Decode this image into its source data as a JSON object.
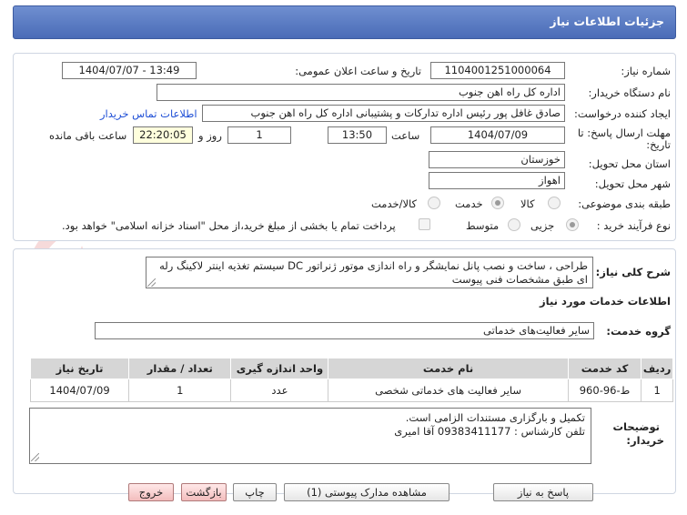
{
  "header": {
    "title": "جزئیات اطلاعات نیاز"
  },
  "form": {
    "need_number_label": "شماره نیاز:",
    "need_number": "1104001251000064",
    "announce_label": "تاریخ و ساعت اعلان عمومی:",
    "announce_value": "1404/07/07 - 13:49",
    "buyer_org_label": "نام دستگاه خریدار:",
    "buyer_org": "اداره کل راه اهن جنوب",
    "creator_label": "ایجاد کننده درخواست:",
    "creator": "صادق غافل پور رئیس اداره تدارکات و پشتیبانی اداره کل راه اهن جنوب",
    "contact_link": "اطلاعات تماس خریدار",
    "deadline_label_1": "مهلت ارسال پاسخ: تا",
    "deadline_label_2": "تاریخ:",
    "deadline_date": "1404/07/09",
    "time_label": "ساعت",
    "deadline_time": "13:50",
    "days_value": "1",
    "days_label": "روز و",
    "remaining_time": "22:20:05",
    "remaining_label": "ساعت باقی مانده",
    "province_label": "استان محل تحویل:",
    "province": "خوزستان",
    "city_label": "شهر محل تحویل:",
    "city": "اهواز",
    "category_label": "طبقه بندی موضوعی:",
    "category_options": [
      "کالا",
      "خدمت",
      "کالا/خدمت"
    ],
    "category_selected": "خدمت",
    "process_label": "نوع فرآیند خرید :",
    "process_options": [
      "جزیی",
      "متوسط"
    ],
    "process_selected": "جزیی",
    "payment_note": "پرداخت تمام یا بخشی از مبلغ خرید،از محل \"اسناد خزانه اسلامی\" خواهد بود."
  },
  "description": {
    "label": "شرح کلی نیاز:",
    "text": "طراحی ، ساخت و نصب پانل نمایشگر و راه اندازی موتور ژنراتور DC سیستم تغذیه اینتر لاکینگ رله ای طبق مشخصات فنی پیوست"
  },
  "services": {
    "section_title": "اطلاعات خدمات مورد نیاز",
    "group_label": "گروه خدمت:",
    "group_value": "سایر فعالیت‌های خدماتی",
    "columns": [
      "ردیف",
      "کد خدمت",
      "نام خدمت",
      "واحد اندازه گیری",
      "تعداد / مقدار",
      "تاریخ نیاز"
    ],
    "rows": [
      {
        "row": "1",
        "code": "ط-96-960",
        "name": "سایر فعالیت های خدماتی شخصی",
        "unit": "عدد",
        "qty": "1",
        "date": "1404/07/09"
      }
    ]
  },
  "buyer_notes": {
    "label_1": "توضیحات",
    "label_2": "خریدار:",
    "line1": "تکمیل و بارگزاری مستندات الزامی است.",
    "line2": "تلفن کارشناس : 09383411177 آقا امیری"
  },
  "buttons": {
    "reply": "پاسخ به نیاز",
    "view_docs": "مشاهده مدارک پیوستی (1)",
    "print": "چاپ",
    "back": "بازگشت",
    "exit": "خروج"
  },
  "watermark": "AriaTender.net",
  "colors": {
    "header": "#4a6cb7",
    "link": "#1f4fd6",
    "highlight": "#ffffdd",
    "table_header": "#d6d6d6"
  }
}
